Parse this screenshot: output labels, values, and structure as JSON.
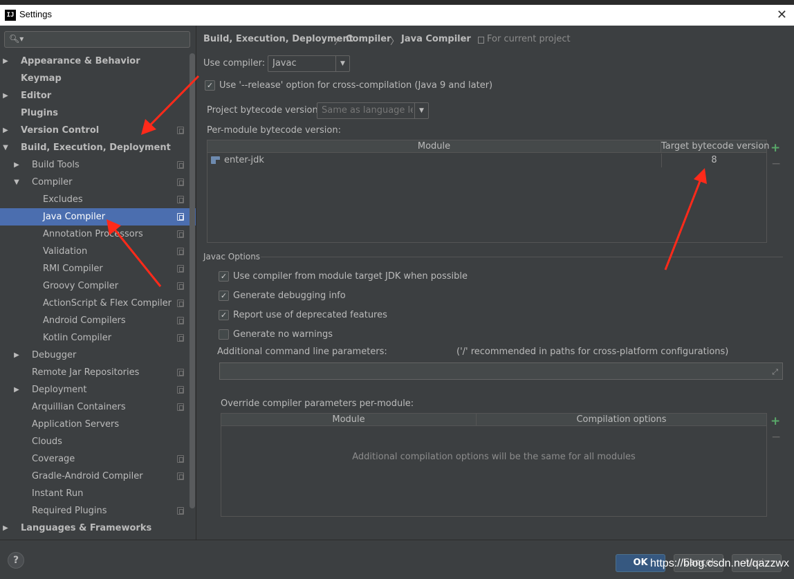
{
  "window": {
    "title": "Settings"
  },
  "sidebar": {
    "search_placeholder": "",
    "items": [
      {
        "label": "Appearance & Behavior",
        "level": 0,
        "arrow": "right",
        "bold": true,
        "proj": false
      },
      {
        "label": "Keymap",
        "level": 0,
        "arrow": "",
        "bold": true,
        "proj": false
      },
      {
        "label": "Editor",
        "level": 0,
        "arrow": "right",
        "bold": true,
        "proj": false
      },
      {
        "label": "Plugins",
        "level": 0,
        "arrow": "",
        "bold": true,
        "proj": false
      },
      {
        "label": "Version Control",
        "level": 0,
        "arrow": "right",
        "bold": true,
        "proj": true
      },
      {
        "label": "Build, Execution, Deployment",
        "level": 0,
        "arrow": "down",
        "bold": true,
        "proj": false
      },
      {
        "label": "Build Tools",
        "level": 1,
        "arrow": "right",
        "bold": false,
        "proj": true
      },
      {
        "label": "Compiler",
        "level": 1,
        "arrow": "down",
        "bold": false,
        "proj": true
      },
      {
        "label": "Excludes",
        "level": 2,
        "arrow": "",
        "bold": false,
        "proj": true
      },
      {
        "label": "Java Compiler",
        "level": 2,
        "arrow": "",
        "bold": false,
        "proj": true,
        "selected": true
      },
      {
        "label": "Annotation Processors",
        "level": 2,
        "arrow": "",
        "bold": false,
        "proj": true
      },
      {
        "label": "Validation",
        "level": 2,
        "arrow": "",
        "bold": false,
        "proj": true
      },
      {
        "label": "RMI Compiler",
        "level": 2,
        "arrow": "",
        "bold": false,
        "proj": true
      },
      {
        "label": "Groovy Compiler",
        "level": 2,
        "arrow": "",
        "bold": false,
        "proj": true
      },
      {
        "label": "ActionScript & Flex Compiler",
        "level": 2,
        "arrow": "",
        "bold": false,
        "proj": true
      },
      {
        "label": "Android Compilers",
        "level": 2,
        "arrow": "",
        "bold": false,
        "proj": true
      },
      {
        "label": "Kotlin Compiler",
        "level": 2,
        "arrow": "",
        "bold": false,
        "proj": true
      },
      {
        "label": "Debugger",
        "level": 1,
        "arrow": "right",
        "bold": false,
        "proj": false
      },
      {
        "label": "Remote Jar Repositories",
        "level": 1,
        "arrow": "",
        "bold": false,
        "proj": true
      },
      {
        "label": "Deployment",
        "level": 1,
        "arrow": "right",
        "bold": false,
        "proj": true
      },
      {
        "label": "Arquillian Containers",
        "level": 1,
        "arrow": "",
        "bold": false,
        "proj": true
      },
      {
        "label": "Application Servers",
        "level": 1,
        "arrow": "",
        "bold": false,
        "proj": false
      },
      {
        "label": "Clouds",
        "level": 1,
        "arrow": "",
        "bold": false,
        "proj": false
      },
      {
        "label": "Coverage",
        "level": 1,
        "arrow": "",
        "bold": false,
        "proj": true
      },
      {
        "label": "Gradle-Android Compiler",
        "level": 1,
        "arrow": "",
        "bold": false,
        "proj": true
      },
      {
        "label": "Instant Run",
        "level": 1,
        "arrow": "",
        "bold": false,
        "proj": false
      },
      {
        "label": "Required Plugins",
        "level": 1,
        "arrow": "",
        "bold": false,
        "proj": true
      },
      {
        "label": "Languages & Frameworks",
        "level": 0,
        "arrow": "right",
        "bold": true,
        "proj": false
      }
    ]
  },
  "breadcrumb": {
    "part1": "Build, Execution, Deployment",
    "sep": "〉",
    "part2": "Compiler",
    "part3": "Java Compiler",
    "scope": "For current project"
  },
  "compiler": {
    "use_compiler_label": "Use compiler:",
    "use_compiler_value": "Javac",
    "release_option_label": "Use '--release' option for cross-compilation (Java 9 and later)",
    "release_option_checked": true,
    "project_bytecode_label": "Project bytecode version:",
    "project_bytecode_value": "Same as language level",
    "per_module_label": "Per-module bytecode version:",
    "module_table": {
      "col_module": "Module",
      "col_target": "Target bytecode version",
      "rows": [
        {
          "module": "enter-jdk",
          "target": "8"
        }
      ]
    }
  },
  "javac": {
    "section_title": "Javac Options",
    "options": [
      {
        "label": "Use compiler from module target JDK when possible",
        "checked": true
      },
      {
        "label": "Generate debugging info",
        "checked": true
      },
      {
        "label": "Report use of deprecated features",
        "checked": true
      },
      {
        "label": "Generate no warnings",
        "checked": false
      }
    ],
    "additional_params_label": "Additional command line parameters:",
    "additional_params_hint": "('/' recommended in paths for cross-platform configurations)",
    "additional_params_value": "",
    "override_label": "Override compiler parameters per-module:",
    "override_table": {
      "col_module": "Module",
      "col_options": "Compilation options",
      "empty_text": "Additional compilation options will be the same for all modules"
    }
  },
  "buttons": {
    "ok": "OK",
    "cancel": "Cancel",
    "apply": "Apply",
    "help": "?"
  },
  "watermark": "https://blog.csdn.net/qazzwx",
  "icons": {
    "add": "plus-icon",
    "remove": "minus-icon",
    "expand": "expand-icon",
    "search": "search-icon"
  },
  "colors": {
    "selection": "#4b6eaf",
    "background": "#3c3f41",
    "add_green": "#59a869",
    "ok_button": "#365880",
    "annotation_red": "#ff2a1a"
  }
}
